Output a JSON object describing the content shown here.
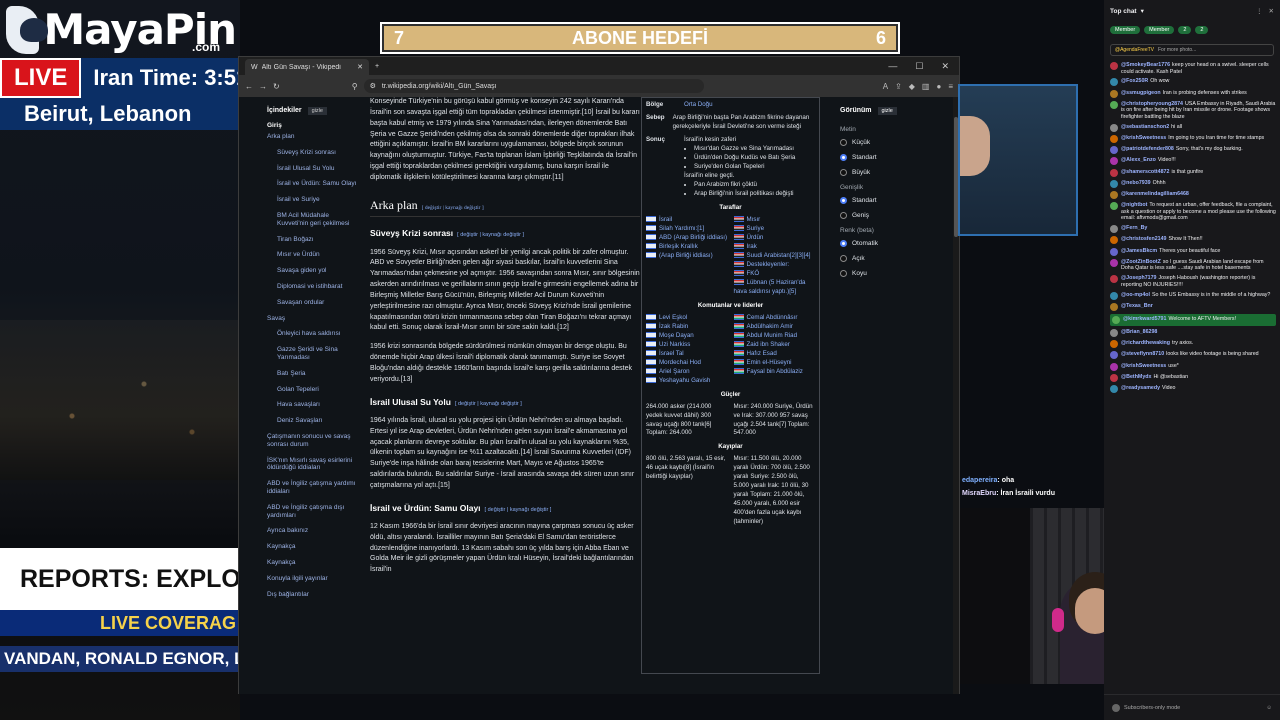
{
  "news": {
    "logo_main": "MayaPin",
    "logo_suffix": ".com",
    "live": "LIVE",
    "iran_time": "Iran Time: 3:51",
    "location": "Beirut, Lebanon",
    "headline": "REPORTS: EXPLOS",
    "live_coverage": "LIVE COVERAG",
    "ticker": "VANDAN, RONALD EGNOR, LOU"
  },
  "goal": {
    "current": "7",
    "label": "ABONE HEDEFİ",
    "target": "6",
    "fill_fraction": 1.0
  },
  "browser": {
    "tab_title": "Altı Gün Savaşı - Vikipedi",
    "url": "tr.wikipedia.org/wiki/Altı_Gün_Savaşı"
  },
  "toc": {
    "title": "İçindekiler",
    "hide": "gizle",
    "start": "Giriş",
    "items": [
      {
        "label": "Arka plan",
        "lvl": 1
      },
      {
        "label": "Süveyş Krizi sonrası",
        "lvl": 2
      },
      {
        "label": "İsrail Ulusal Su Yolu",
        "lvl": 2
      },
      {
        "label": "İsrail ve Ürdün: Samu Olayı",
        "lvl": 2
      },
      {
        "label": "İsrail ve Suriye",
        "lvl": 2
      },
      {
        "label": "BM Acil Müdahale Kuvveti'nin geri çekilmesi",
        "lvl": 2
      },
      {
        "label": "Tiran Boğazı",
        "lvl": 2
      },
      {
        "label": "Mısır ve Ürdün",
        "lvl": 2
      },
      {
        "label": "Savaşa giden yol",
        "lvl": 2
      },
      {
        "label": "Diplomasi ve istihbarat",
        "lvl": 2
      },
      {
        "label": "Savaşan ordular",
        "lvl": 2
      },
      {
        "label": "Savaş",
        "lvl": 1
      },
      {
        "label": "Önleyici hava saldırısı",
        "lvl": 2
      },
      {
        "label": "Gazze Şeridi ve Sina Yarımadası",
        "lvl": 2
      },
      {
        "label": "Batı Şeria",
        "lvl": 2
      },
      {
        "label": "Golan Tepeleri",
        "lvl": 2
      },
      {
        "label": "Hava savaşları",
        "lvl": 2
      },
      {
        "label": "Deniz Savaşları",
        "lvl": 2
      },
      {
        "label": "Çatışmanın sonucu ve savaş sonrası durum",
        "lvl": 1
      },
      {
        "label": "İSK'nın Mısırlı savaş esirlerini öldürdüğü iddiaları",
        "lvl": 1
      },
      {
        "label": "ABD ve İngiliz çatışma yardımı iddiaları",
        "lvl": 1
      },
      {
        "label": "ABD ve İngiliz çatışma dışı yardımları",
        "lvl": 1
      },
      {
        "label": "Ayrıca bakınız",
        "lvl": 1
      },
      {
        "label": "Kaynakça",
        "lvl": 1
      },
      {
        "label": "Kaynakça",
        "lvl": 1
      },
      {
        "label": "Konuyla ilgili yayınlar",
        "lvl": 1
      },
      {
        "label": "Dış bağlantılar",
        "lvl": 1
      }
    ]
  },
  "article": {
    "p0": "Konseyinde Türkiye'nin bu görüşü kabul görmüş ve konseyin 242 sayılı Kararı'nda İsrail'in son savaşta işgal ettiği tüm toprakladan çekilmesi istenmiştir.[10] İsrail bu kararı başta kabul etmiş ve 1979 yılında Sina Yarımadası'ndan, ilerleyen dönemlerde Batı Şeria ve Gazze Şeridi'nden çekilmiş olsa da sonraki dönemlerde diğer toprakları ilhak ettiğini açıklamıştır. İsrail'in BM kararlarını uygulamaması, bölgede birçok sorunun kaynağını oluşturmuştur. Türkiye, Fas'ta toplanan İslam İşbirliği Teşkilatında da İsrail'in işgal ettiği topraklardan çekilmesi gerektiğini vurgulamış, buna karşın İsrail ile diplomatik ilişkilerin kötüleştirilmesi kararına karşı çıkmıştır.[11]",
    "h2": "Arka plan",
    "edit": "[ değiştir | kaynağı değiştir ]",
    "h3a": "Süveyş Krizi sonrası",
    "p1": "1956 Süveyş Krizi, Mısır açısından askerî bir yenilgi ancak politik bir zafer olmuştur. ABD ve Sovyetler Birliği'nden gelen ağır siyasi baskılar, İsrail'in kuvvetlerini Sina Yarımadası'ndan çekmesine yol açmıştır. 1956 savaşından sonra Mısır, sınır bölgesinin askerden arındırılması ve gerillaların sınırı geçip İsrail'e girmesini engellemek adına bir Birleşmiş Milletler Barış Gücü'nün, Birleşmiş Milletler Acil Durum Kuvveti'nin yerleştirilmesine razı olmuştur. Ayrıca Mısır, önceki Süveyş Krizi'nde İsrail gemilerine kapatılmasından ötürü krizin tırmanmasına sebep olan Tiran Boğazı'nı tekrar açmayı kabul etti. Sonuç olarak İsrail-Mısır sınırı bir süre sakin kaldı.[12]",
    "p2": "1956 krizi sonrasında bölgede sürdürülmesi mümkün olmayan bir denge oluştu. Bu dönemde hiçbir Arap ülkesi İsrail'i diplomatik olarak tanımamıştı. Suriye ise Sovyet Bloğu'ndan aldığı destekle 1960'ların başında İsrail'e karşı gerilla saldırılarına destek veriyordu.[13]",
    "h3b": "İsrail Ulusal Su Yolu",
    "p3": "1964 yılında İsrail, ulusal su yolu projesi için Ürdün Nehri'nden su almaya başladı. Ertesi yıl ise Arap devletleri, Ürdün Nehri'nden gelen suyun İsrail'e akmamasına yol açacak planlarını devreye soktular. Bu plan İsrail'in ulusal su yolu kaynaklarını %35, ülkenin toplam su kaynağını ise %11 azaltacaktı.[14] İsrail Savunma Kuvvetleri (IDF) Suriye'de inşa hâlinde olan baraj tesislerine Mart, Mayıs ve Ağustos 1965'te saldırılarda bulundu. Bu saldırılar Suriye - İsrail arasında savaşa dek süren uzun sınır çatışmalarına yol açtı.[15]",
    "h3c": "İsrail ve Ürdün: Samu Olayı",
    "p4": "12 Kasım 1966'da bir İsrail sınır devriyesi aracının mayına çarpması sonucu üç asker öldü, altısı yaralandı. İsrailliler mayının Batı Şeria'daki El Samu'dan teröristlerce düzenlendiğine inanıyorlardı. 13 Kasım sabahı son üç yılda barış için Abba Eban ve Golda Meir ile gizli görüşmeler yapan Ürdün kralı Hüseyin, İsrail'deki bağlantılarından İsrail'in"
  },
  "infobox": {
    "bolge_k": "Bölge",
    "bolge_v": "Orta Doğu",
    "sebep_k": "Sebep",
    "sebep_v": "Arap Birliği'nin başta Pan Arabizm fikrine dayanan gerekçeleriyle İsrail Devleti'ne son verme isteği",
    "sonuc_k": "Sonuç",
    "sonuc_v": "İsrail'in kesin zaferi",
    "sonuc_list": [
      "Mısır'dan Gazze ve Sina Yarımadası",
      "Ürdün'den Doğu Kudüs ve Batı Şeria",
      "Suriye'den Golan Tepeleri"
    ],
    "sonuc_v2": "İsrail'in eline geçti.",
    "sonuc_list2": [
      "Pan Arabizm fikri çöktü",
      "Arap Birliği'nin İsrail politikası değişti"
    ],
    "taraflar": "Taraflar",
    "side_a": [
      "İsrail",
      "Silah Yardımı:[1]",
      "ABD (Arap Birliği iddiası)",
      "Birleşik Krallık",
      "(Arap Birliği iddiası)"
    ],
    "side_b": [
      "Mısır",
      "Suriye",
      "Ürdün",
      "Irak",
      "Suudi Arabistan[2][3][4]",
      "Destekleyenler:",
      "FKÖ",
      "Lübnan (5 Haziran'da hava saldırısı yaptı.)[5]"
    ],
    "komutanlar": "Komutanlar ve liderler",
    "cmd_a": [
      "Levi Eşkol",
      "İzak Rabin",
      "Moşe Dayan",
      "Uzi Narkiss",
      "İsrael Tal",
      "Mordechai Hod",
      "Ariel Şaron",
      "Yeshayahu Gavish"
    ],
    "cmd_b": [
      "Cemal Abdünnâsır",
      "Abdülhakim Amir",
      "Abdul Munim Riad",
      "Zaid ibn Shaker",
      "Hafız Esad",
      "Emin el-Hüseyni",
      "Faysal bin Abdülaziz"
    ],
    "guc_a": "264.000 asker (214.000 yedek kuvvet dâhil) 300 savaş uçağı 800 tank[6] Toplam: 264.000",
    "guc_b": "Mısır: 240.000 Suriye, Ürdün ve Irak: 307.000 957 savaş uçağı 2.504 tank[7] Toplam: 547.000",
    "guclar": "Güçler",
    "kayiplar": "Kayıplar",
    "kay_a": "800 ölü, 2.563 yaralı, 15 esir, 46 uçak kaybı[8] (İsrail'in belirttiği kayıplar)",
    "kay_b": "Mısır: 11.500 ölü, 20.000 yaralı Ürdün: 700 ölü, 2.500 yaralı Suriye: 2.500 ölü, 5.000 yaralı Irak: 10 ölü, 30 yaralı Toplam: 21.000 ölü, 45.000 yaralı, 6.000 esir 400'den fazla uçak kaybı (tahminler)"
  },
  "appearance": {
    "title": "Görünüm",
    "hide": "gizle",
    "metin": "Metin",
    "metin_opts": [
      "Küçük",
      "Standart",
      "Büyük"
    ],
    "genislik": "Genişlik",
    "genislik_opts": [
      "Standart",
      "Geniş"
    ],
    "renk": "Renk (beta)",
    "renk_opts": [
      "Otomatik",
      "Açık",
      "Koyu"
    ]
  },
  "overlay_chat": [
    {
      "user": "edapereira",
      "text": ": oha"
    },
    {
      "user": "MisraEbru",
      "text": ": İran İsraili vurdu"
    }
  ],
  "chat": {
    "title": "Top chat",
    "badges": [
      "Member",
      "Member",
      "2",
      "2"
    ],
    "pinned_user": "@AgendaFreeTV",
    "pinned_text": "For more photo...",
    "messages": [
      {
        "u": "@SmokeyBear1776",
        "t": "keep your head on a swivel. sleeper cells could activate. Kash Patel"
      },
      {
        "u": "@Fox250R",
        "t": "Oh wow"
      },
      {
        "u": "@ssmugpigeon",
        "t": "Iran is probing defenses with strikes"
      },
      {
        "u": "@christopheryoung2874",
        "t": "USA Embassy in Riyadh, Saudi Arabia is on fire after being hit by Iran missile or drone. Footage shows firefighter battling the blaze"
      },
      {
        "u": "@sebastianschon2",
        "t": "hi all"
      },
      {
        "u": "@krishSweetness",
        "t": "Im going to you Iran time for time stamps"
      },
      {
        "u": "@patriotdefender808",
        "t": "Sorry, that's my dog barking."
      },
      {
        "u": "@Alexx_Enzo",
        "t": "Video!!!"
      },
      {
        "u": "@shamerscott4872",
        "t": "is that gunfire"
      },
      {
        "u": "@nebo7939",
        "t": "Ohhh"
      },
      {
        "u": "@karenmelindagilliam6468",
        "t": ""
      },
      {
        "u": "@nightbot",
        "t": "To request an urban, offer feedback, file a complaint, ask a question or apply to become a mod please use the following email: aftvmods@gmail.com"
      },
      {
        "u": "@Fern_By",
        "t": ""
      },
      {
        "u": "@christosfen2149",
        "t": "Show It Then!!"
      },
      {
        "u": "@JamesBkcm",
        "t": "Theres your beautiful face"
      },
      {
        "u": "@ZootZinBootZ",
        "t": "so I guess Saudi Arabian land escape from Doha Qatar is less safe ....stay safe in hotel basements"
      },
      {
        "u": "@Joseph7179",
        "t": "Joseph Haboush (washington reporter) is reporting NO INJURIES!!!!"
      },
      {
        "u": "@oo-mp4ol",
        "t": "So the US Embassy is in the middle of a highway?"
      },
      {
        "u": "@Texas_Bnr",
        "t": ""
      },
      {
        "u": "@kimrkward5791",
        "t": "Welcome to AFTV Members!"
      },
      {
        "u": "@Brian_86298",
        "t": ""
      },
      {
        "u": "@richardthewaking",
        "t": "try axios."
      },
      {
        "u": "@steveflynn8710",
        "t": "looks like video footage is being shared"
      },
      {
        "u": "@krishSweetness",
        "t": "use*"
      },
      {
        "u": "@BethMydx",
        "t": "Hi @sebastian"
      },
      {
        "u": "@readysamedy",
        "t": "Video"
      }
    ],
    "footer": "Subscribers-only mode"
  }
}
